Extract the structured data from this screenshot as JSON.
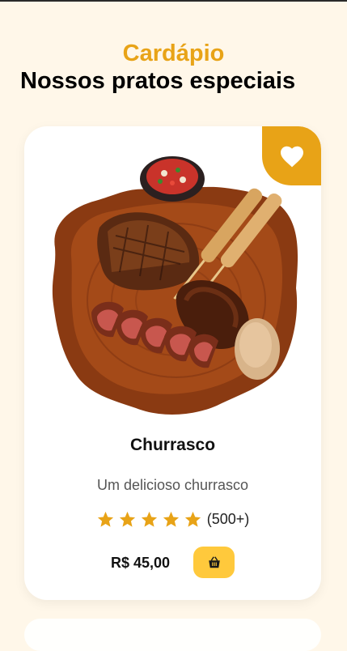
{
  "section": {
    "subtitle": "Cardápio",
    "title": "Nossos pratos especiais"
  },
  "card": {
    "favorite_icon": "heart-icon",
    "image_alt": "Churrasco",
    "name": "Churrasco",
    "description": "Um delicioso churrasco",
    "rating_stars": 5,
    "rating_count": "(500+)",
    "price": "R$ 45,00",
    "cart_icon": "shopping-basket-icon"
  },
  "colors": {
    "accent": "#e8a317",
    "cart_button": "#ffc93c",
    "background": "#fff7e9"
  }
}
